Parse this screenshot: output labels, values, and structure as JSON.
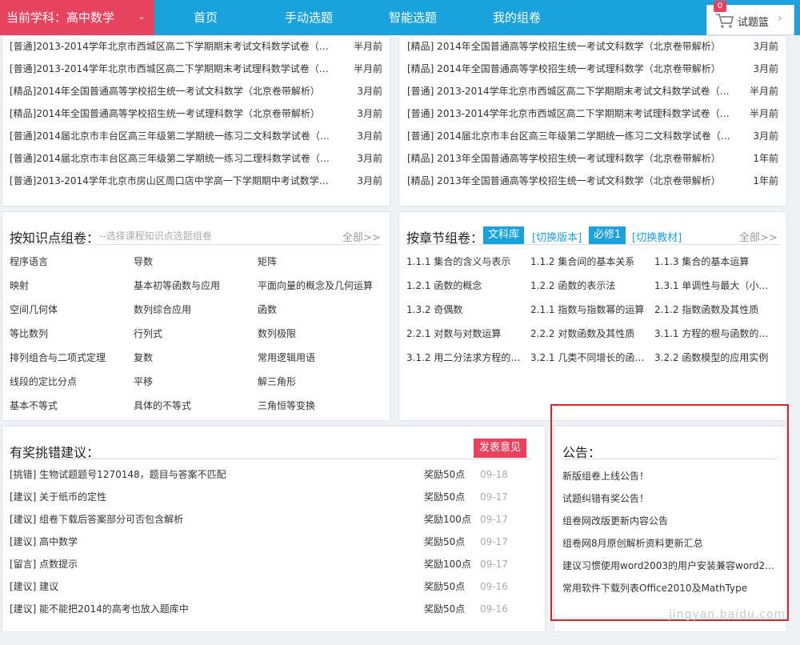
{
  "nav": {
    "subject_label": "当前学科：高中数学",
    "caret": "⌄",
    "items": [
      "首页",
      "手动选题",
      "智能选题",
      "我的组卷"
    ],
    "basket_label": "试题篮",
    "basket_count": "0",
    "basket_arrow": "›"
  },
  "papers_left": [
    {
      "title": "[普通]2013-2014学年北京市西城区高二下学期期末考试文科数学试卷（带…",
      "date": "半月前"
    },
    {
      "title": "[普通]2013-2014学年北京市西城区高二下学期期末考试理科数学试卷（带…",
      "date": "半月前"
    },
    {
      "title": "[精品]2014年全国普通高等学校招生统一考试文科数学（北京卷带解析）",
      "date": "3月前"
    },
    {
      "title": "[精品]2014年全国普通高等学校招生统一考试理科数学（北京卷带解析）",
      "date": "3月前"
    },
    {
      "title": "[普通]2014届北京市丰台区高三年级第二学期统一练习二文科数学试卷（带…",
      "date": "3月前"
    },
    {
      "title": "[普通]2014届北京市丰台区高三年级第二学期统一练习二理科数学试卷（带…",
      "date": "3月前"
    },
    {
      "title": "[普通]2013-2014学年北京市房山区周口店中学高一下学期期中考试数学试…",
      "date": "3月前"
    }
  ],
  "papers_right": [
    {
      "title": "[精品] 2014年全国普通高等学校招生统一考试文科数学（北京卷带解析）",
      "date": "3月前"
    },
    {
      "title": "[精品] 2014年全国普通高等学校招生统一考试理科数学（北京卷带解析）",
      "date": "3月前"
    },
    {
      "title": "[普通] 2013-2014学年北京市西城区高二下学期期末考试文科数学试卷（带…",
      "date": "半月前"
    },
    {
      "title": "[普通] 2013-2014学年北京市西城区高二下学期期末考试理科数学试卷（带…",
      "date": "半月前"
    },
    {
      "title": "[普通] 2014届北京市丰台区高三年级第二学期统一练习二文科数学试卷（带…",
      "date": "3月前"
    },
    {
      "title": "[精品] 2013年全国普通高等学校招生统一考试理科数学（北京卷带解析）",
      "date": "1年前"
    },
    {
      "title": "[精品] 2013年全国普通高等学校招生统一考试文科数学（北京卷带解析）",
      "date": "1年前"
    }
  ],
  "knowledge": {
    "title": "按知识点组卷：",
    "hint": "--选择课程知识点选题组卷",
    "more": "全部>>",
    "points": [
      "程序语言",
      "导数",
      "矩阵",
      "映射",
      "基本初等函数与应用",
      "平面向量的概念及几何运算",
      "空间几何体",
      "数列综合应用",
      "函数",
      "等比数列",
      "行列式",
      "数列极限",
      "排列组合与二项式定理",
      "复数",
      "常用逻辑用语",
      "线段的定比分点",
      "平移",
      "解三角形",
      "基本不等式",
      "具体的不等式",
      "三角恒等变换"
    ]
  },
  "chapter": {
    "title": "按章节组卷：",
    "tag_library": "文科库",
    "switch_version": "[切换版本]",
    "tag_book": "必修1",
    "switch_book": "[切换教材]",
    "more": "全部>>",
    "items": [
      "1.1.1 集合的含义与表示",
      "1.1.2 集合间的基本关系",
      "1.1.3 集合的基本运算",
      "1.2.1 函数的概念",
      "1.2.2 函数的表示法",
      "1.3.1 单调性与最大（小）…",
      "1.3.2 奇偶数",
      "2.1.1 指数与指数幂的运算",
      "2.1.2 指数函数及其性质",
      "2.2.1 对数与对数运算",
      "2.2.2 对数函数及其性质",
      "3.1.1 方程的根与函数的零…",
      "3.1.2 用二分法求方程的近…",
      "3.2.1 几类不同增长的函数…",
      "3.2.2 函数模型的应用实例"
    ]
  },
  "feedback": {
    "title": "有奖挑错建议：",
    "button": "发表意见",
    "items": [
      {
        "text": "[挑错] 生物试题题号1270148，题目与答案不匹配",
        "reward": "奖励50点",
        "date": "09-18"
      },
      {
        "text": "[建议] 关于纸币的定性",
        "reward": "奖励50点",
        "date": "09-17"
      },
      {
        "text": "[建议] 组卷下载后答案部分可否包含解析",
        "reward": "奖励100点",
        "date": "09-17"
      },
      {
        "text": "[建议] 高中数学",
        "reward": "奖励50点",
        "date": "09-17"
      },
      {
        "text": "[留言] 点数提示",
        "reward": "奖励100点",
        "date": "09-17"
      },
      {
        "text": "[建议] 建议",
        "reward": "奖励50点",
        "date": "09-16"
      },
      {
        "text": "[建议] 能不能把2014的高考也放入题库中",
        "reward": "奖励50点",
        "date": "09-16"
      }
    ]
  },
  "notice": {
    "title": "公告：",
    "items": [
      "新版组卷上线公告！",
      "试题纠错有奖公告！",
      "组卷网改版更新内容公告",
      "组卷网8月原创解析资料更新汇总",
      "建议习惯使用word2003的用户安装兼容word20…",
      "常用软件下载列表Office2010及MathType"
    ]
  },
  "watermark": "jingyan.baidu.com",
  "colors": {
    "nav_blue": "#1aa2dc",
    "subject_red": "#e8435e",
    "highlight_red": "#d9232a"
  }
}
